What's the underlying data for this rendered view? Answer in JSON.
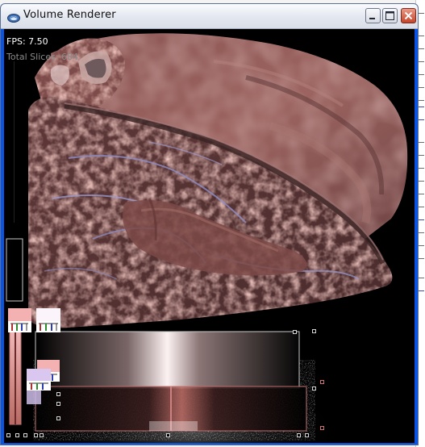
{
  "window": {
    "title": "Volume Renderer",
    "icon": "java-cup-icon"
  },
  "controls": {
    "minimize_icon": "minimize-icon",
    "maximize_icon": "maximize-icon",
    "close_icon": "close-icon"
  },
  "overlay": {
    "fps": "FPS: 7.50",
    "total_slices": "Total Slices: 684"
  },
  "colors": {
    "titlebar_top": "#fafbfe",
    "titlebar_bottom": "#d9dee8",
    "close_red": "#c5452b",
    "viewport_bg": "#000000",
    "tissue": "#b87a72",
    "tissue_dark": "#6b3c3a",
    "vessel": "#8f8fc8",
    "widget_outline": "#c8c8c8",
    "widget_outline_red": "#c07070"
  }
}
